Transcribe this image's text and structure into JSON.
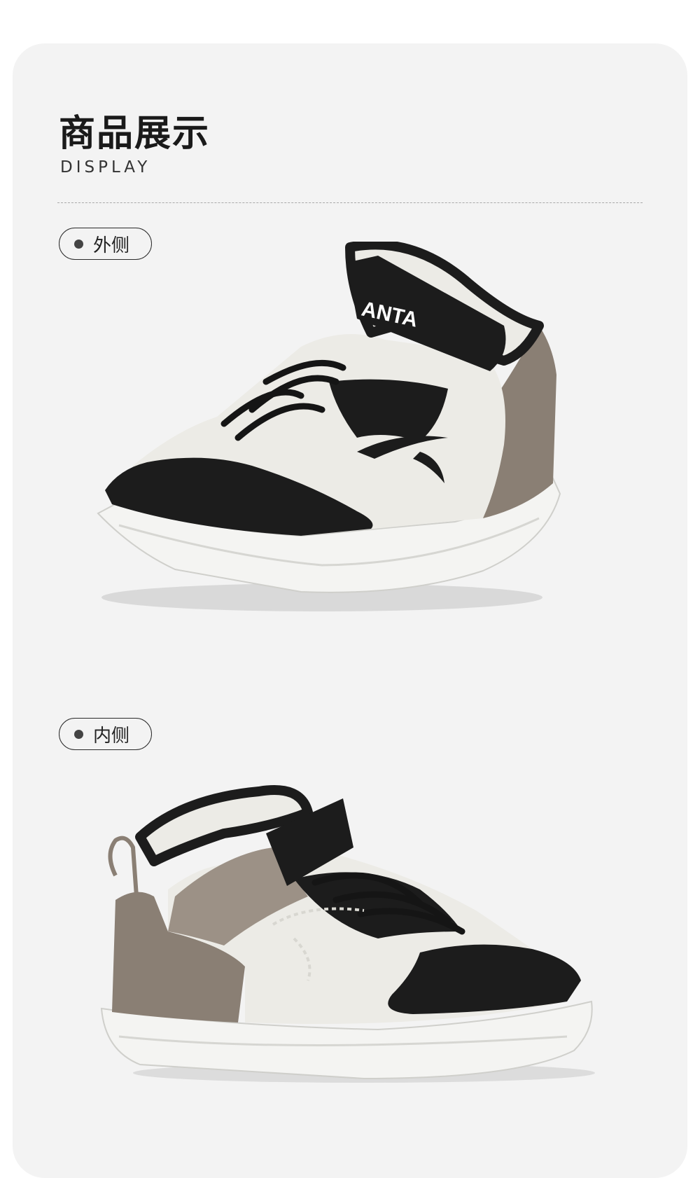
{
  "header": {
    "title": "商品展示",
    "subtitle": "DISPLAY"
  },
  "views": [
    {
      "label": "外侧"
    },
    {
      "label": "内侧"
    }
  ],
  "shoe": {
    "brand_text": "ANTA"
  },
  "colors": {
    "card_background": "#f3f3f3",
    "upper_white": "#ecebe6",
    "upper_black": "#1c1c1c",
    "upper_taupe": "#8a7f74",
    "sole": "#f4f4f2"
  }
}
